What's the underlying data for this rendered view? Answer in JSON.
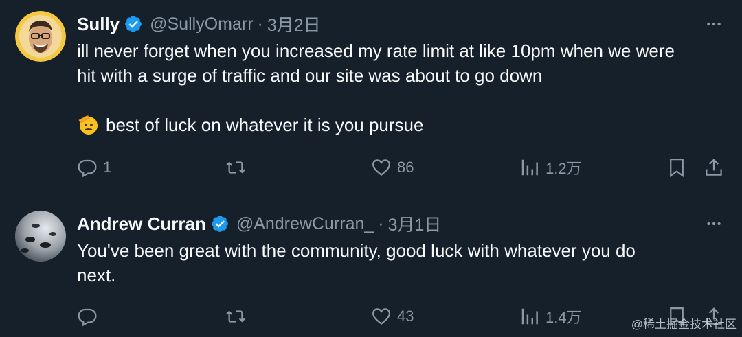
{
  "colors": {
    "background": "#15202b",
    "text_primary": "#f7f9f9",
    "text_secondary": "#8b98a5",
    "verified_badge": "#1d9bf0",
    "divider": "#38444d"
  },
  "tweets": [
    {
      "name": "Sully",
      "handle": "@SullyOmarr",
      "separator": "·",
      "date": "3月2日",
      "lines": [
        "ill never forget when you increased my rate limit at like 10pm when we were",
        "hit with a surge of traffic and our site was about to go down"
      ],
      "emoji_line": "best of luck on whatever it is you pursue",
      "emoji_icon": "saluting-face-emoji",
      "actions": {
        "reply_count": "1",
        "retweet_count": "",
        "like_count": "86",
        "view_count": "1.2万"
      }
    },
    {
      "name": "Andrew Curran",
      "handle": "@AndrewCurran_",
      "separator": "·",
      "date": "3月1日",
      "lines": [
        "You've been great with the community, good luck with whatever you do",
        "next."
      ],
      "actions": {
        "reply_count": "",
        "retweet_count": "",
        "like_count": "43",
        "view_count": "1.4万"
      }
    }
  ],
  "watermark": "@稀土掘金技术社区"
}
